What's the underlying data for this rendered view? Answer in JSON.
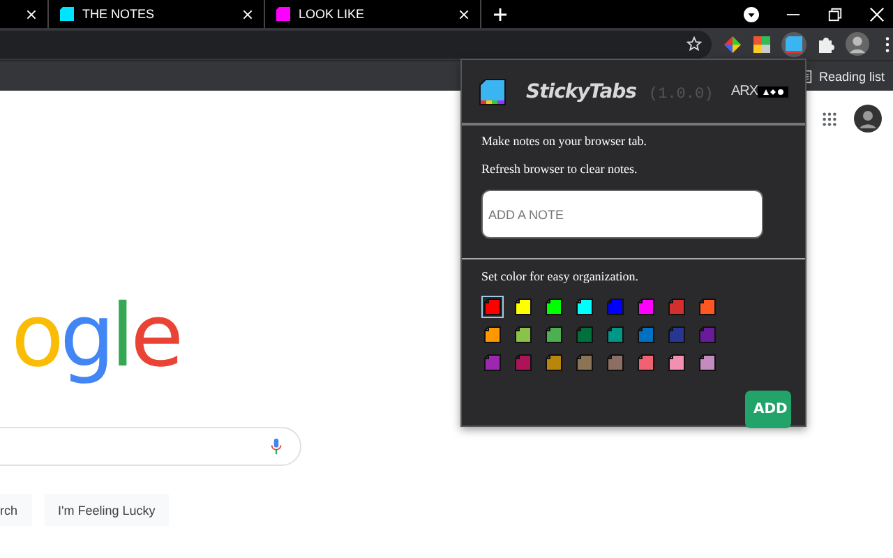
{
  "tabs": [
    {
      "selected": false
    },
    {
      "title": "THE NOTES",
      "color": "#00e5ff",
      "selected": false
    },
    {
      "title": "LOOK LIKE",
      "color": "#ff00ff",
      "selected": false
    }
  ],
  "toolbar": {
    "bookmark_item": "Reading list"
  },
  "page": {
    "logo": [
      {
        "letter": "o",
        "color": "#fbbc05"
      },
      {
        "letter": "g",
        "color": "#4285f4"
      },
      {
        "letter": "l",
        "color": "#34a853"
      },
      {
        "letter": "e",
        "color": "#ea4335"
      }
    ],
    "buttons": [
      "rch",
      "I'm Feeling Lucky"
    ]
  },
  "popup": {
    "title": "StickyTabs",
    "version": "(1.0.0)",
    "brand": "ARX",
    "lines": [
      "Make notes on your browser tab.",
      "Refresh browser to clear notes."
    ],
    "note_field": {
      "placeholder": "ADD A NOTE"
    },
    "color_prompt": "Set color for easy organization.",
    "colors": [
      {
        "color": "#ff0000",
        "selected": true
      },
      {
        "color": "#ffff00",
        "selected": false
      },
      {
        "color": "#00ff00",
        "selected": false
      },
      {
        "color": "#00ffff",
        "selected": false
      },
      {
        "color": "#0000ff",
        "selected": false
      },
      {
        "color": "#ff00ff",
        "selected": false
      },
      {
        "color": "#d32f2f",
        "selected": false
      },
      {
        "color": "#ff5722",
        "selected": false
      },
      {
        "color": "#ff9800",
        "selected": false
      },
      {
        "color": "#8bc34a",
        "selected": false
      },
      {
        "color": "#4caf50",
        "selected": false
      },
      {
        "color": "#00703c",
        "selected": false
      },
      {
        "color": "#009688",
        "selected": false
      },
      {
        "color": "#0070c0",
        "selected": false
      },
      {
        "color": "#283593",
        "selected": false
      },
      {
        "color": "#6a1b9a",
        "selected": false
      },
      {
        "color": "#9c27b0",
        "selected": false
      },
      {
        "color": "#ad1457",
        "selected": false
      },
      {
        "color": "#b8860b",
        "selected": false
      },
      {
        "color": "#8b7355",
        "selected": false
      },
      {
        "color": "#8d6e63",
        "selected": false
      },
      {
        "color": "#f06272",
        "selected": false
      },
      {
        "color": "#f48fb1",
        "selected": false
      },
      {
        "color": "#c48bbf",
        "selected": false
      }
    ],
    "add_button": "ADD"
  }
}
